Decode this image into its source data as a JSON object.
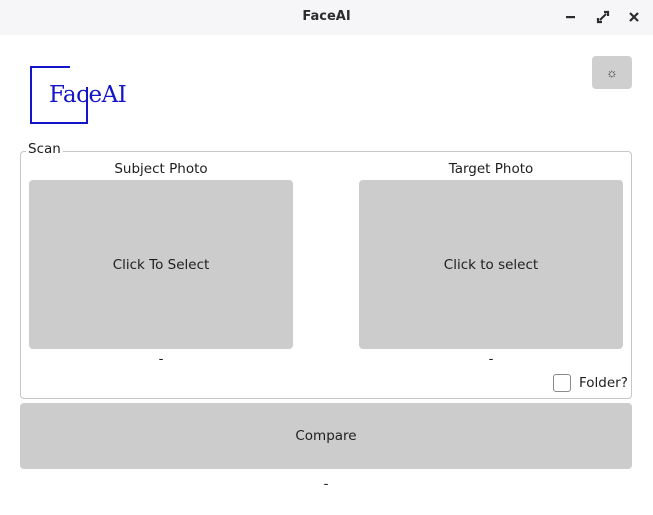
{
  "window": {
    "title": "FaceAI",
    "controls": [
      "minimize-icon",
      "maximize-icon",
      "close-icon"
    ]
  },
  "logo": {
    "text": "FaceAI",
    "color": "#1414c8"
  },
  "theme_toggle": {
    "icon": "sun-icon",
    "glyph": "☼"
  },
  "scan": {
    "legend": "Scan",
    "subject": {
      "label": "Subject Photo",
      "placeholder": "Click To Select",
      "status": "-"
    },
    "target": {
      "label": "Target Photo",
      "placeholder": "Click to select",
      "status": "-"
    },
    "folder": {
      "label": "Folder?",
      "checked": false
    }
  },
  "compare": {
    "label": "Compare",
    "status": "-"
  }
}
